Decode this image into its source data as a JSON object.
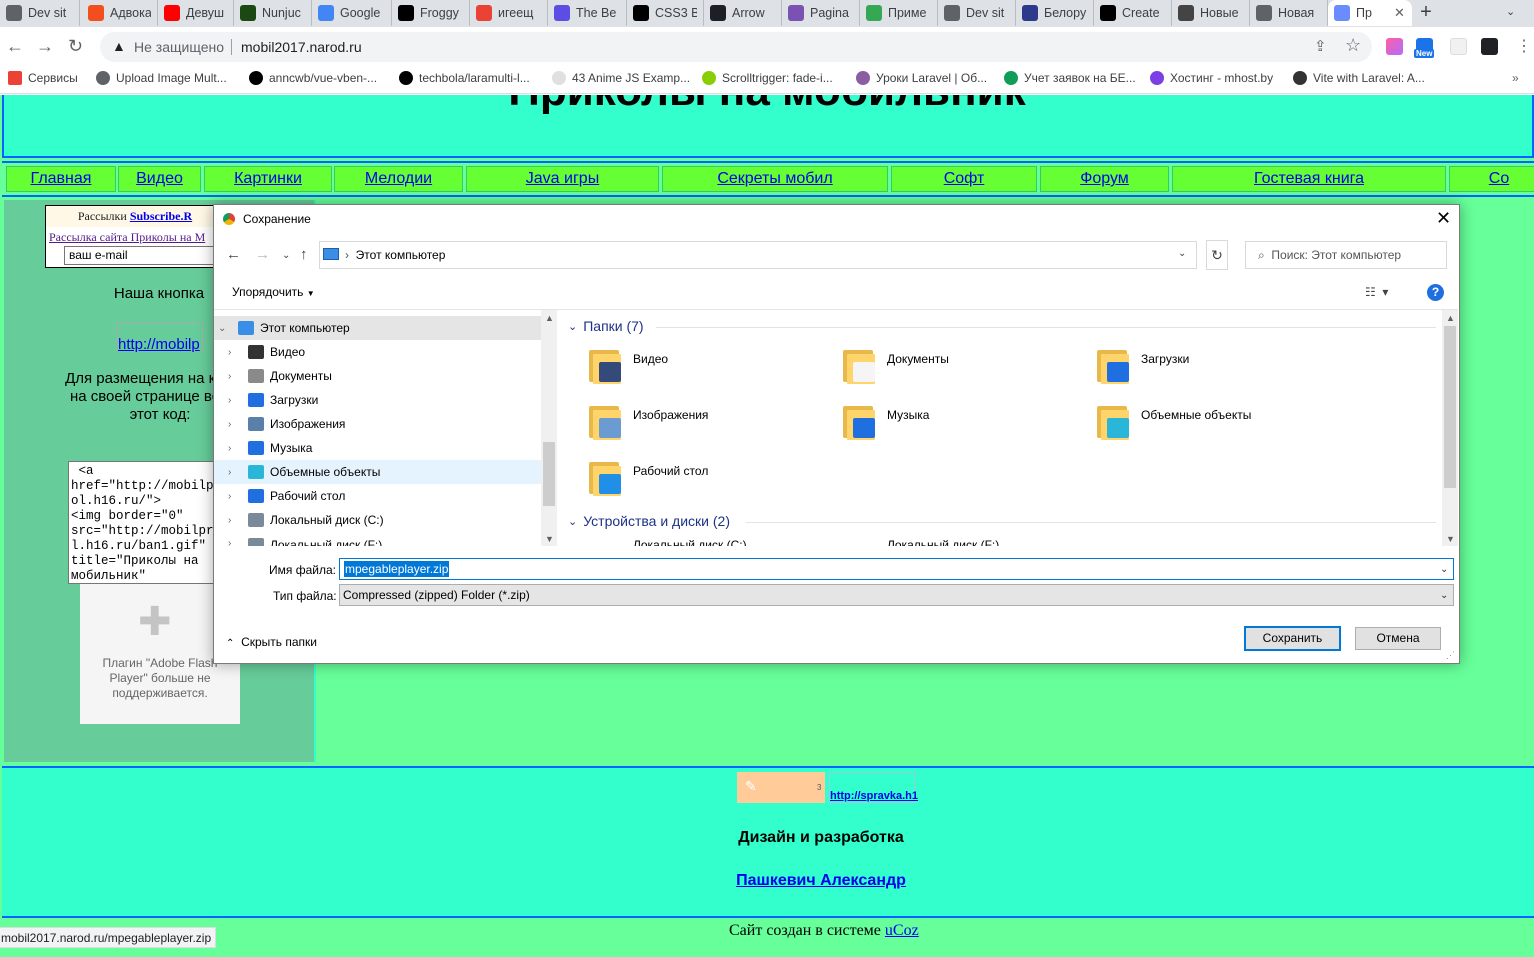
{
  "tabs": [
    {
      "title": "Dev sit",
      "icon": "globe-icon",
      "color": "#5f6368"
    },
    {
      "title": "Адвока",
      "icon": "figma-icon",
      "color": "#f24e1e"
    },
    {
      "title": "Девуш",
      "icon": "youtube-icon",
      "color": "#ff0000"
    },
    {
      "title": "Nunjuc",
      "icon": "nunjucks-icon",
      "color": "#1c4913"
    },
    {
      "title": "Google",
      "icon": "translate-icon",
      "color": "#4285f4"
    },
    {
      "title": "Froggy",
      "icon": "github-icon",
      "color": "#000000"
    },
    {
      "title": "игеещ",
      "icon": "google-icon",
      "color": "#ea4335"
    },
    {
      "title": "The Be",
      "icon": "six-icon",
      "color": "#5c4ee5"
    },
    {
      "title": "CSS3 B",
      "icon": "codepen-icon",
      "color": "#000000"
    },
    {
      "title": "Arrow",
      "icon": "codepen-icon",
      "color": "#1e1f26"
    },
    {
      "title": "Pagina",
      "icon": "bootstrap-icon",
      "color": "#7952b3"
    },
    {
      "title": "Приме",
      "icon": "loop-icon",
      "color": "#34a853"
    },
    {
      "title": "Dev sit",
      "icon": "globe-icon",
      "color": "#5f6368"
    },
    {
      "title": "Белору",
      "icon": "triangle-icon",
      "color": "#2d3a8c"
    },
    {
      "title": "Create",
      "icon": "wix-icon",
      "color": "#000000"
    },
    {
      "title": "Новые",
      "icon": "square-icon",
      "color": "#444444"
    },
    {
      "title": "Новая",
      "icon": "chrome-icon",
      "color": "#5f6368"
    },
    {
      "title": "Пр",
      "icon": "shield-icon",
      "color": "#6b8cff"
    }
  ],
  "toolbar": {
    "not_secure": "Не защищено",
    "url": "mobil2017.narod.ru",
    "new_badge": "New"
  },
  "bookmarks": [
    {
      "label": "Сервисы",
      "icon": "apps-icon",
      "color": "#ea4335"
    },
    {
      "label": "Upload Image Mult...",
      "icon": "globe-icon",
      "color": "#5f6368"
    },
    {
      "label": "anncwb/vue-vben-...",
      "icon": "github-icon",
      "color": "#000000"
    },
    {
      "label": "techbola/laramulti-l...",
      "icon": "github-icon",
      "color": "#000000"
    },
    {
      "label": "43 Anime JS Examp...",
      "icon": "bookmark-icon",
      "color": "#e0e0e0"
    },
    {
      "label": "Scrolltrigger: fade-i...",
      "icon": "greensock-icon",
      "color": "#88ce02"
    },
    {
      "label": "Уроки Laravel | Об...",
      "icon": "laravel-icon",
      "color": "#8a5ea0"
    },
    {
      "label": "Учет заявок на БЕ...",
      "icon": "sheets-icon",
      "color": "#0f9d58"
    },
    {
      "label": "Хостинг - mhost.by",
      "icon": "mhost-icon",
      "color": "#7b3fe4"
    },
    {
      "label": "Vite with Laravel: A...",
      "icon": "site-icon",
      "color": "#333333"
    }
  ],
  "site": {
    "title": "Приколы на мобильник",
    "nav": [
      "Главная",
      "Видео",
      "Картинки",
      "Мелодии",
      "Java игры",
      "Секреты мобил",
      "Софт",
      "Форум",
      "Гостевая книга",
      "Со"
    ],
    "subscribe_prefix": "Рассылки ",
    "subscribe_link": "Subscribe.R",
    "subscribe_site": "Рассылка сайта Приколы на М",
    "email_placeholder": "ваш e-mail",
    "our_button": "Наша кнопка",
    "button_img_alt": "http://mobilp",
    "place_text": "Для размещения на кнопки на своей странице вставь этот код:",
    "code": " <a\nhref=\"http://mobilpr\nol.h16.ru/\">\n<img border=\"0\"\nsrc=\"http://mobilpri\nl.h16.ru/ban1.gif\"\ntitle=\"Приколы на\nмобильник\"",
    "flash_text": "Плагин \"Adobe Flash Player\" больше не поддерживается.",
    "counter_num": "3",
    "counter_link": "http://spravka.h1",
    "design": "Дизайн и разработка",
    "author": "Пашкевич Александр",
    "made_prefix": "Сайт создан в системе ",
    "made_link": "uCoz",
    "status_url": "mobil2017.narod.ru/mpegableplayer.zip"
  },
  "dialog": {
    "title": "Сохранение",
    "path": "Этот компьютер",
    "search_placeholder": "Поиск: Этот компьютер",
    "organize": "Упорядочить",
    "tree": [
      {
        "label": "Этот компьютер",
        "icon": "computer-icon",
        "color": "#3a8ee6"
      },
      {
        "label": "Видео",
        "icon": "video-folder-icon",
        "color": "#333333"
      },
      {
        "label": "Документы",
        "icon": "documents-folder-icon",
        "color": "#8a8a8a"
      },
      {
        "label": "Загрузки",
        "icon": "downloads-folder-icon",
        "color": "#1f6fe0"
      },
      {
        "label": "Изображения",
        "icon": "pictures-folder-icon",
        "color": "#5a7fa8"
      },
      {
        "label": "Музыка",
        "icon": "music-folder-icon",
        "color": "#1f6fe0"
      },
      {
        "label": "Объемные объекты",
        "icon": "3d-objects-icon",
        "color": "#29b6d8"
      },
      {
        "label": "Рабочий стол",
        "icon": "desktop-folder-icon",
        "color": "#1f6fe0"
      },
      {
        "label": "Локальный диск (C:)",
        "icon": "drive-c-icon",
        "color": "#7a8a99"
      },
      {
        "label": "Локальный диск (F:)",
        "icon": "drive-f-icon",
        "color": "#7a8a99"
      }
    ],
    "folders_header": "Папки (7)",
    "folders": [
      {
        "label": "Видео",
        "icon": "video-folder-icon",
        "overlay": "#334a7a"
      },
      {
        "label": "Документы",
        "icon": "documents-folder-icon",
        "overlay": "#f5f5f5"
      },
      {
        "label": "Загрузки",
        "icon": "downloads-folder-icon",
        "overlay": "#1f6fe0"
      },
      {
        "label": "Изображения",
        "icon": "pictures-folder-icon",
        "overlay": "#6c9bd1"
      },
      {
        "label": "Музыка",
        "icon": "music-folder-icon",
        "overlay": "#1f6fe0"
      },
      {
        "label": "Объемные объекты",
        "icon": "3d-objects-icon",
        "overlay": "#29b6d8"
      },
      {
        "label": "Рабочий стол",
        "icon": "desktop-folder-icon",
        "overlay": "#1f8fe8"
      }
    ],
    "devices_header": "Устройства и диски (2)",
    "devices": [
      "Локальный диск (C:)",
      "Локальный диск (F:)"
    ],
    "filename_label": "Имя файла:",
    "filename": "mpegableplayer.zip",
    "filetype_label": "Тип файла:",
    "filetype": "Compressed (zipped) Folder (*.zip)",
    "hide_folders": "Скрыть папки",
    "save": "Сохранить",
    "cancel": "Отмена"
  }
}
